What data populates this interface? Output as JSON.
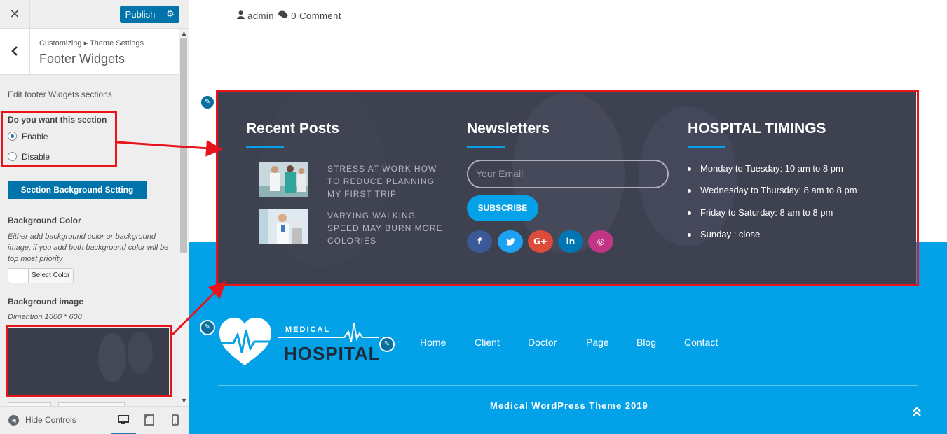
{
  "sidebar": {
    "close_glyph": "✕",
    "publish_label": "Publish",
    "settings_icon": "gear-icon",
    "back_glyph": "‹",
    "breadcrumb": "Customizing ▸ Theme Settings",
    "panel_title": "Footer Widgets",
    "description": "Edit footer Widgets sections",
    "question": "Do you want this section",
    "radio_options": [
      {
        "label": "Enable",
        "selected": true
      },
      {
        "label": "Disable",
        "selected": false
      }
    ],
    "section_button": "Section Background Setting",
    "bg_color_title": "Background Color",
    "bg_color_desc": "Either add background color or background image, if you add both background color will be top most priority",
    "select_color_label": "Select Color",
    "bg_image_title": "Background image",
    "dimension_note": "Dimention 1600 * 600",
    "hide_controls_label": "Hide Controls",
    "devices": [
      "desktop",
      "tablet",
      "mobile"
    ],
    "active_device": "desktop"
  },
  "post_meta": {
    "author": "admin",
    "comments": "0 Comment"
  },
  "footer_widgets": {
    "recent_posts": {
      "title": "Recent Posts",
      "posts": [
        {
          "title": "STRESS AT WORK HOW TO REDUCE PLANNING MY FIRST TRIP"
        },
        {
          "title": "VARYING WALKING SPEED MAY BURN MORE COLORIES"
        }
      ]
    },
    "newsletter": {
      "title": "Newsletters",
      "email_placeholder": "Your Email",
      "subscribe_label": "SUBSCRIBE",
      "social": [
        {
          "name": "facebook",
          "glyph": "f",
          "color": "#3b5998"
        },
        {
          "name": "twitter",
          "glyph": "t",
          "color": "#1da1f2"
        },
        {
          "name": "google-plus",
          "glyph": "G+",
          "color": "#dd4b39"
        },
        {
          "name": "linkedin",
          "glyph": "in",
          "color": "#0077b5"
        },
        {
          "name": "instagram",
          "glyph": "◎",
          "color": "#c13584"
        }
      ]
    },
    "timings": {
      "title": "HOSPITAL TIMINGS",
      "items": [
        "Monday to Tuesday:  10 am to 8 pm",
        "Wednesday  to Thursday:   8 am to 8 pm",
        "Friday   to Saturday:   8 am to 8 pm",
        "Sunday : close"
      ]
    }
  },
  "footer": {
    "logo_top": "MEDICAL",
    "logo_bottom": "HOSPITAL",
    "nav": [
      "Home",
      "Client",
      "Doctor",
      "Page",
      "Blog",
      "Contact"
    ],
    "copyright": "Medical WordPress Theme 2019",
    "to_top_glyph": "⌃"
  },
  "colors": {
    "accent": "#02a1e8",
    "wp_blue": "#0073aa",
    "footer_bg": "#3e4250",
    "highlight_red": "#e8141c"
  }
}
